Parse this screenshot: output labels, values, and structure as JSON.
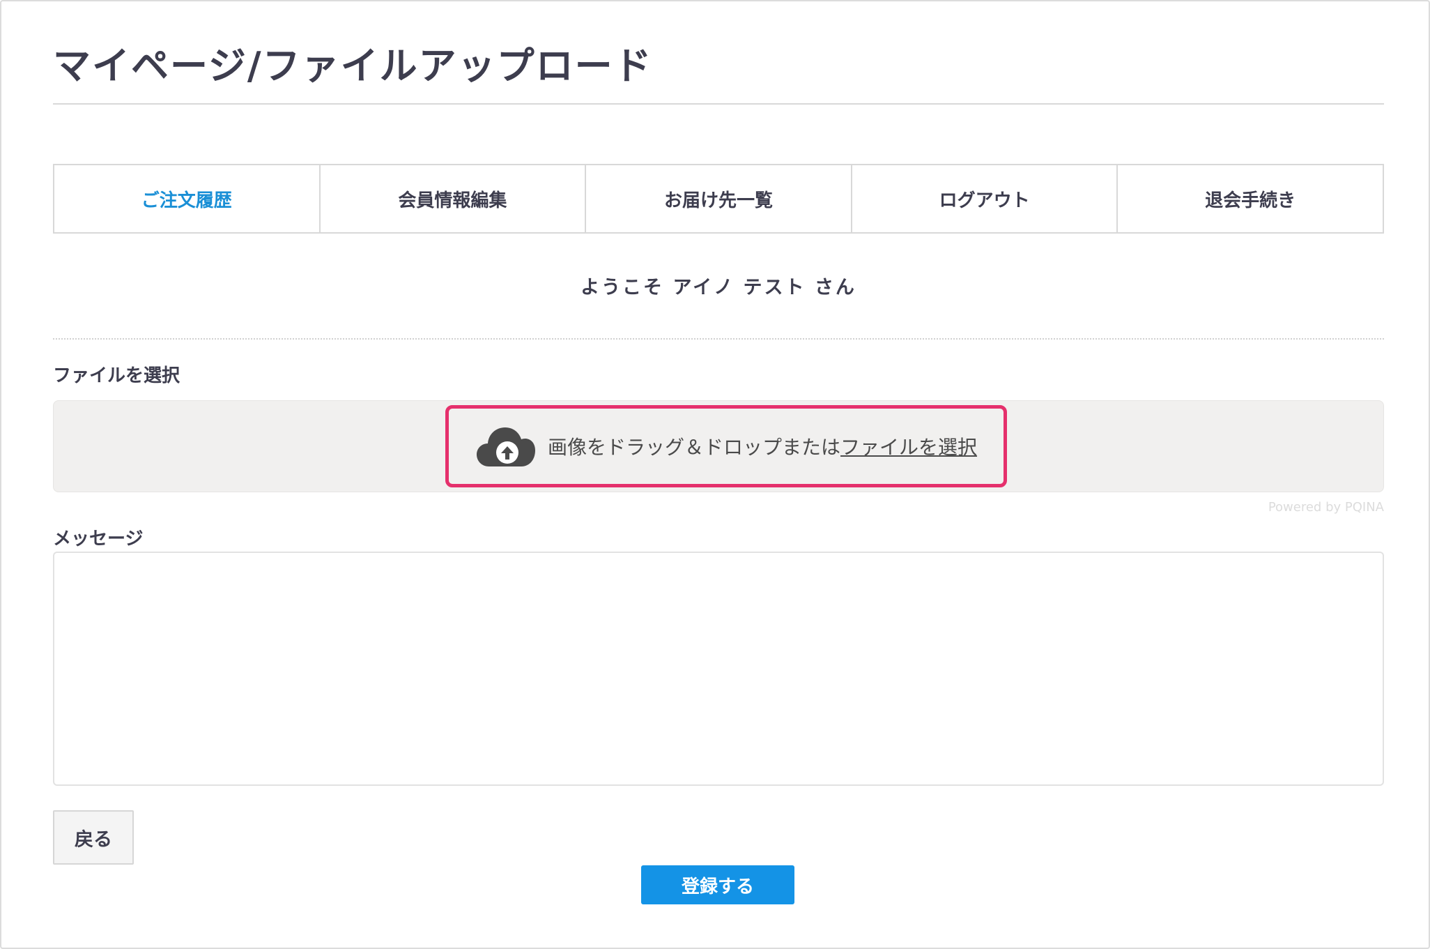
{
  "page": {
    "title": "マイページ/ファイルアップロード"
  },
  "tabs": [
    {
      "label": "ご注文履歴",
      "active": true
    },
    {
      "label": "会員情報編集",
      "active": false
    },
    {
      "label": "お届け先一覧",
      "active": false
    },
    {
      "label": "ログアウト",
      "active": false
    },
    {
      "label": "退会手続き",
      "active": false
    }
  ],
  "welcome": "ようこそ アイノ テスト さん",
  "file_section": {
    "label": "ファイルを選択",
    "dropzone": {
      "icon": "cloud-upload-icon",
      "text": "画像をドラッグ＆ドロップまたは",
      "link": "ファイルを選択"
    },
    "powered_by": "Powered by PQINA"
  },
  "message_section": {
    "label": "メッセージ",
    "value": ""
  },
  "buttons": {
    "back": "戻る",
    "submit": "登録する"
  },
  "colors": {
    "accent": "#1a8fd6",
    "submit_bg": "#1493e6",
    "highlight": "#e5306c",
    "dropzone_bg": "#f1f0ef"
  }
}
